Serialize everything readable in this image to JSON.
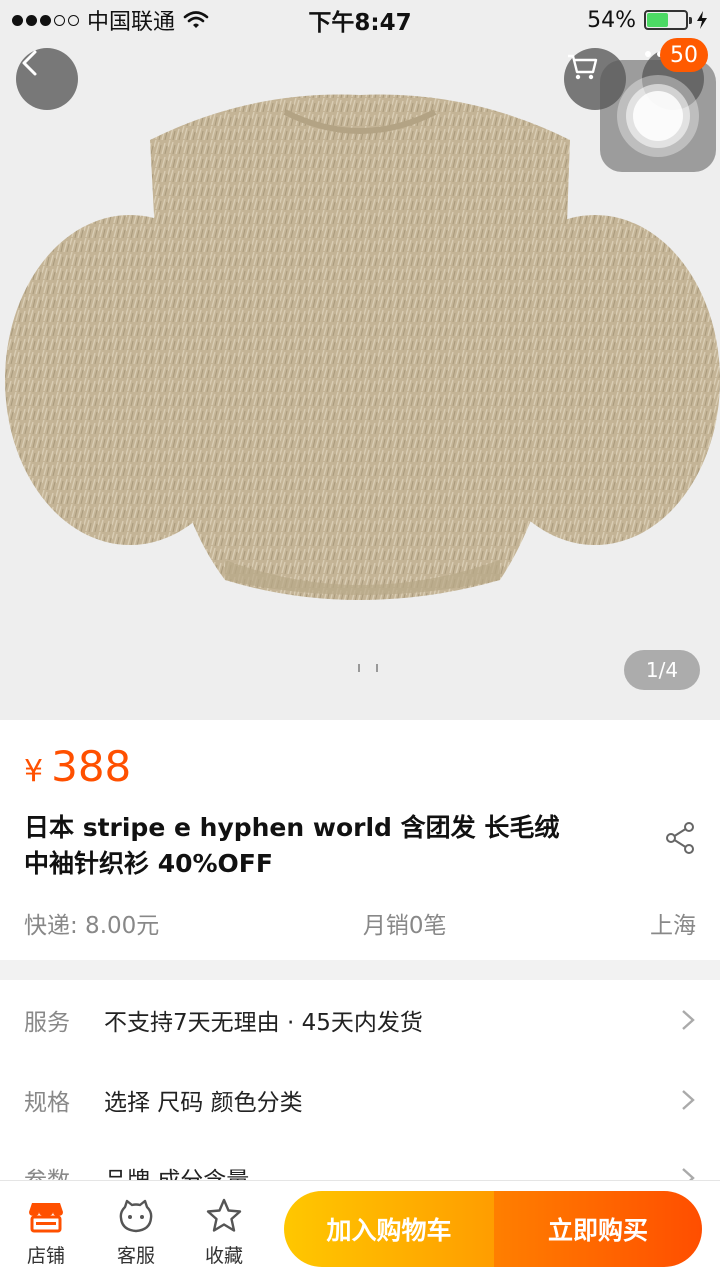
{
  "status_bar": {
    "carrier": "中国联通",
    "time": "下午8:47",
    "battery": "54%",
    "battery_level": 0.54,
    "icons": [
      "signal-dots-icon",
      "wifi-icon",
      "battery-icon",
      "charging-bolt-icon"
    ]
  },
  "hero": {
    "pager": "1/4",
    "cart_badge": "50",
    "icons": [
      "back-arrow-icon",
      "cart-icon",
      "more-dots-icon"
    ]
  },
  "product": {
    "currency": "¥",
    "price": "388",
    "title_line1": "日本 stripe e hyphen world 含团发 长毛绒",
    "title_line2": "中袖针织衫 40%OFF",
    "shipping": "快递: 8.00元",
    "monthly_sales": "月销0笔",
    "location": "上海"
  },
  "options": [
    {
      "label": "服务",
      "value": "不支持7天无理由 · 45天内发货"
    },
    {
      "label": "规格",
      "value": "选择  尺码 颜色分类"
    },
    {
      "label": "参数",
      "value": "品牌 成分含量"
    }
  ],
  "bottom_bar": {
    "store": "店铺",
    "service": "客服",
    "favorite": "收藏",
    "add_to_cart": "加入购物车",
    "buy_now": "立即购买"
  },
  "colors": {
    "accent": "#ff5000",
    "cart_gradient": "#ffc700",
    "buy_gradient": "#ff4e00",
    "sweater": "#c7b79a"
  }
}
